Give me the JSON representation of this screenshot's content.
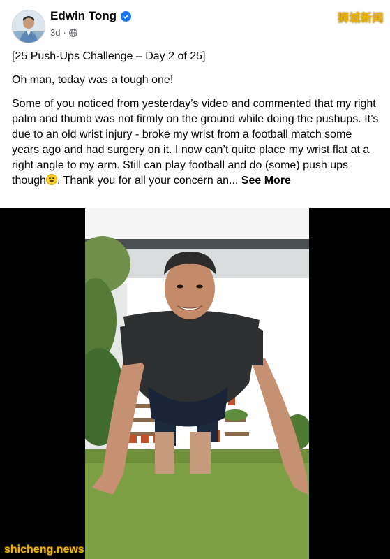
{
  "post": {
    "author": "Edwin Tong",
    "time": "3d",
    "paragraphs": [
      "[25 Push-Ups Challenge – Day 2 of 25]",
      "Oh man, today was a tough one!"
    ],
    "body_main": "Some of you noticed from yesterday’s video and commented that my right palm and thumb was not firmly on the ground while doing the pushups.  It’s due to an old wrist injury - broke my wrist from a football match some years ago and had surgery on it. I now can’t quite place my wrist flat at a right angle to my arm.  Still can play football and do (some) push ups though",
    "body_tail": ".  Thank you for all your concern an...",
    "see_more": "See More"
  },
  "watermarks": {
    "top": "狮城新闻",
    "bottom": "shicheng.news"
  },
  "colors": {
    "verified": "#1877f2",
    "meta": "#65676b",
    "watermark": "#f0b400"
  },
  "icons": [
    "verified-badge-icon",
    "globe-icon",
    "grinning-sweat-emoji"
  ]
}
